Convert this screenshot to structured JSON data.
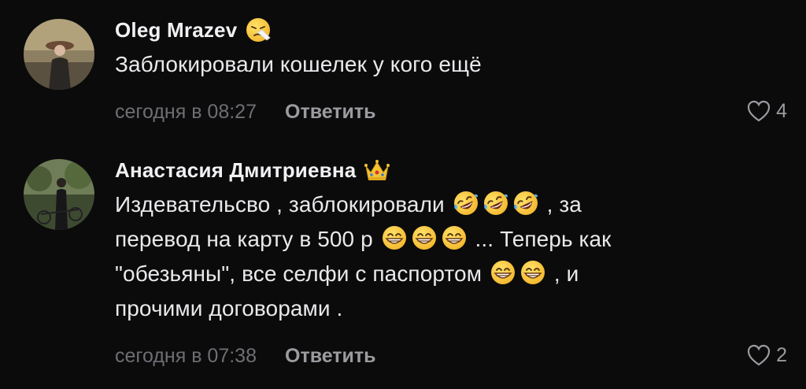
{
  "comments": [
    {
      "author": "Oleg Mrazev",
      "author_emoji": "sneezing-face-icon",
      "text": "Заблокировали кошелек у кого ещё",
      "time": "сегодня в 08:27",
      "reply_label": "Ответить",
      "likes": "4"
    },
    {
      "author": "Анастасия Дмитриевна",
      "author_emoji": "crown-icon",
      "text_parts": [
        "Издевательсво , заблокировали",
        ", за",
        "перевод на карту в 500 р",
        "... Теперь как",
        "\"обезьяны\", все селфи с паспортом",
        ", и",
        "прочими договорами ."
      ],
      "inline_emojis": [
        "rofl-face-icon",
        "grinning-face-icon"
      ],
      "time": "сегодня в 07:38",
      "reply_label": "Ответить",
      "likes": "2"
    }
  ],
  "colors": {
    "background": "#0b0b0c",
    "text_primary": "#e9e9eb",
    "text_meta": "#6e6e73",
    "action": "#9b9ba0",
    "emoji_yellow": "#f7c63a"
  }
}
